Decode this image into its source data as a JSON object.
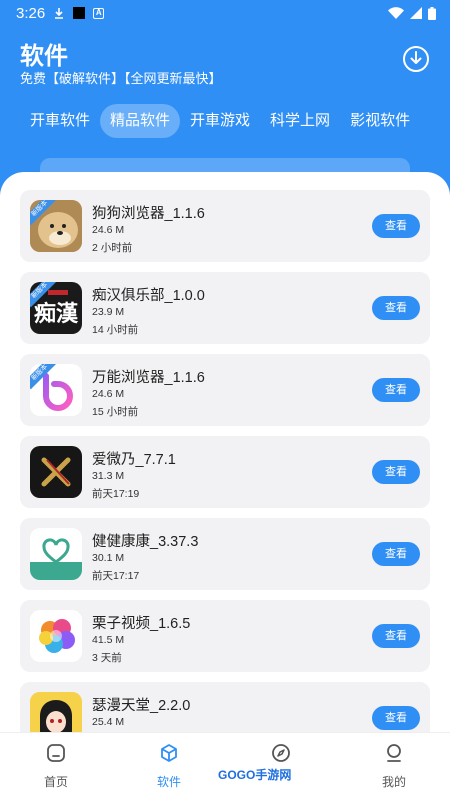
{
  "status": {
    "time": "3:26"
  },
  "header": {
    "title": "软件",
    "subtitle": "免费【破解软件】【全网更新最快】"
  },
  "tabs": [
    {
      "label": "开車软件"
    },
    {
      "label": "精品软件",
      "active": true
    },
    {
      "label": "开車游戏"
    },
    {
      "label": "科学上网"
    },
    {
      "label": "影视软件"
    }
  ],
  "apps": [
    {
      "name": "狗狗浏览器_1.1.6",
      "size": "24.6 M",
      "time": "2 小时前",
      "button": "查看",
      "badge": "新版本",
      "icon": "doge-icon"
    },
    {
      "name": "痴汉俱乐部_1.0.0",
      "size": "23.9 M",
      "time": "14 小时前",
      "button": "查看",
      "badge": "新版本",
      "icon": "chihan-icon",
      "icon_text": "痴漢"
    },
    {
      "name": "万能浏览器_1.1.6",
      "size": "24.6 M",
      "time": "15 小时前",
      "button": "查看",
      "badge": "新版本",
      "icon": "b-logo-icon"
    },
    {
      "name": "爱微乃_7.7.1",
      "size": "31.3 M",
      "time": "前天17:19",
      "button": "查看",
      "icon": "x-logo-icon"
    },
    {
      "name": "健健康康_3.37.3",
      "size": "30.1 M",
      "time": "前天17:17",
      "button": "查看",
      "icon": "heart-logo-icon"
    },
    {
      "name": "栗子视频_1.6.5",
      "size": "41.5 M",
      "time": "3 天前",
      "button": "查看",
      "icon": "colorful-blob-icon"
    },
    {
      "name": "瑟漫天堂_2.2.0",
      "size": "25.4 M",
      "time": "",
      "button": "查看",
      "icon": "anime-girl-icon"
    }
  ],
  "bottom_nav": [
    {
      "label": "首页",
      "icon": "home-icon"
    },
    {
      "label": "软件",
      "icon": "cube-icon",
      "active": true
    },
    {
      "label": "",
      "icon": "compass-icon"
    },
    {
      "label": "我的",
      "icon": "user-icon"
    }
  ],
  "watermark": "GOGO手游网",
  "colors": {
    "primary": "#2f8ff5",
    "card_bg": "#f2f2f4"
  }
}
